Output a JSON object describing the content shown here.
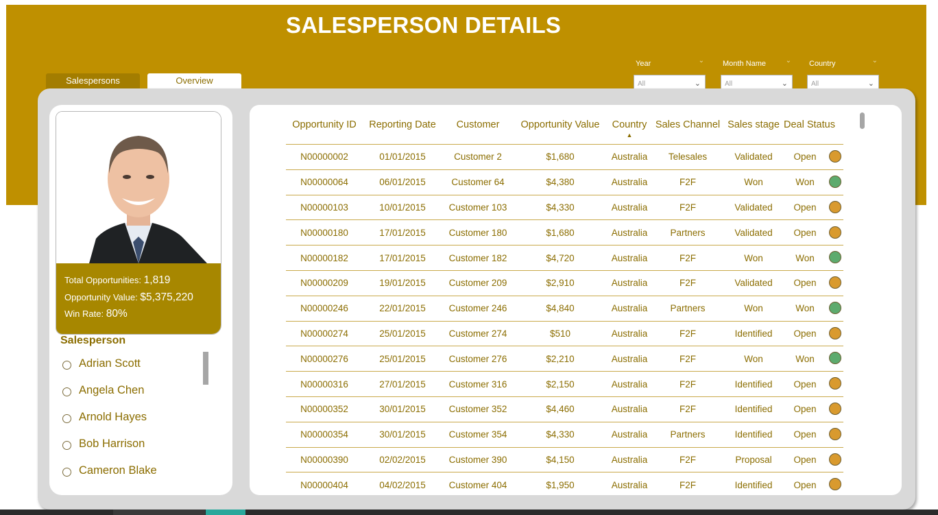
{
  "header": {
    "title": "SALESPERSON DETAILS",
    "tabs": [
      {
        "label": "Salespersons",
        "active": true
      },
      {
        "label": "Overview",
        "active": false
      }
    ],
    "accent_color": "#bf9000"
  },
  "filters": [
    {
      "label": "Year",
      "value": "All"
    },
    {
      "label": "Month Name",
      "value": "All"
    },
    {
      "label": "Country",
      "value": "All"
    }
  ],
  "profile": {
    "photo_icon": "salesperson-photo",
    "total_opportunities_label": "Total Opportunities:",
    "total_opportunities_value": "1,819",
    "opportunity_value_label": "Opportunity Value:",
    "opportunity_value_value": "$5,375,220",
    "win_rate_label": "Win Rate:",
    "win_rate_value": "80%"
  },
  "salesperson_slicer": {
    "title": "Salesperson",
    "items": [
      "Adrian Scott",
      "Angela Chen",
      "Arnold Hayes",
      "Bob Harrison",
      "Cameron Blake"
    ]
  },
  "table": {
    "columns": [
      "Opportunity ID",
      "Reporting Date",
      "Customer",
      "Opportunity Value",
      "Country",
      "Sales Channel",
      "Sales stage",
      "Deal Status"
    ],
    "sorted_column": "Country",
    "status_colors": {
      "Open": "#d99a2e",
      "Won": "#5dab6e"
    },
    "rows": [
      [
        "N00000002",
        "01/01/2015",
        "Customer 2",
        "$1,680",
        "Australia",
        "Telesales",
        "Validated",
        "Open"
      ],
      [
        "N00000064",
        "06/01/2015",
        "Customer 64",
        "$4,380",
        "Australia",
        "F2F",
        "Won",
        "Won"
      ],
      [
        "N00000103",
        "10/01/2015",
        "Customer 103",
        "$4,330",
        "Australia",
        "F2F",
        "Validated",
        "Open"
      ],
      [
        "N00000180",
        "17/01/2015",
        "Customer 180",
        "$1,680",
        "Australia",
        "Partners",
        "Validated",
        "Open"
      ],
      [
        "N00000182",
        "17/01/2015",
        "Customer 182",
        "$4,720",
        "Australia",
        "F2F",
        "Won",
        "Won"
      ],
      [
        "N00000209",
        "19/01/2015",
        "Customer 209",
        "$2,910",
        "Australia",
        "F2F",
        "Validated",
        "Open"
      ],
      [
        "N00000246",
        "22/01/2015",
        "Customer 246",
        "$4,840",
        "Australia",
        "Partners",
        "Won",
        "Won"
      ],
      [
        "N00000274",
        "25/01/2015",
        "Customer 274",
        "$510",
        "Australia",
        "F2F",
        "Identified",
        "Open"
      ],
      [
        "N00000276",
        "25/01/2015",
        "Customer 276",
        "$2,210",
        "Australia",
        "F2F",
        "Won",
        "Won"
      ],
      [
        "N00000316",
        "27/01/2015",
        "Customer 316",
        "$2,150",
        "Australia",
        "F2F",
        "Identified",
        "Open"
      ],
      [
        "N00000352",
        "30/01/2015",
        "Customer 352",
        "$4,460",
        "Australia",
        "F2F",
        "Identified",
        "Open"
      ],
      [
        "N00000354",
        "30/01/2015",
        "Customer 354",
        "$4,330",
        "Australia",
        "Partners",
        "Identified",
        "Open"
      ],
      [
        "N00000390",
        "02/02/2015",
        "Customer 390",
        "$4,150",
        "Australia",
        "F2F",
        "Proposal",
        "Open"
      ],
      [
        "N00000404",
        "04/02/2015",
        "Customer 404",
        "$1,950",
        "Australia",
        "F2F",
        "Identified",
        "Open"
      ]
    ]
  }
}
